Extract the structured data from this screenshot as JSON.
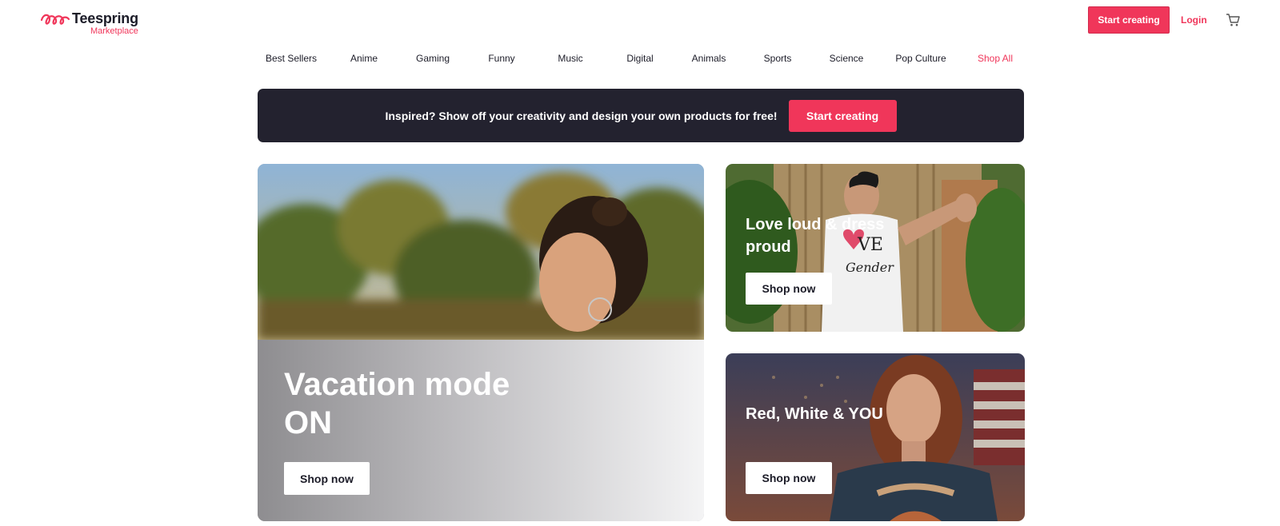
{
  "header": {
    "logo_name": "Teespring",
    "logo_sub": "Marketplace",
    "start_creating": "Start creating",
    "login": "Login",
    "cart_icon": "cart-icon"
  },
  "nav": {
    "items": [
      "Best Sellers",
      "Anime",
      "Gaming",
      "Funny",
      "Music",
      "Digital",
      "Animals",
      "Sports",
      "Science",
      "Pop Culture",
      "Shop All"
    ]
  },
  "promo": {
    "text": "Inspired? Show off your creativity and design your own products for free!",
    "button": "Start creating"
  },
  "hero": {
    "main": {
      "title": "Vacation mode ON",
      "button": "Shop now"
    },
    "card_a": {
      "title": "Love loud & dress proud",
      "button": "Shop now"
    },
    "card_b": {
      "title": "Red, White & YOU",
      "button": "Shop now"
    }
  },
  "colors": {
    "accent": "#f0365a",
    "promo_bg": "#23222f",
    "text": "#1c1c28"
  }
}
